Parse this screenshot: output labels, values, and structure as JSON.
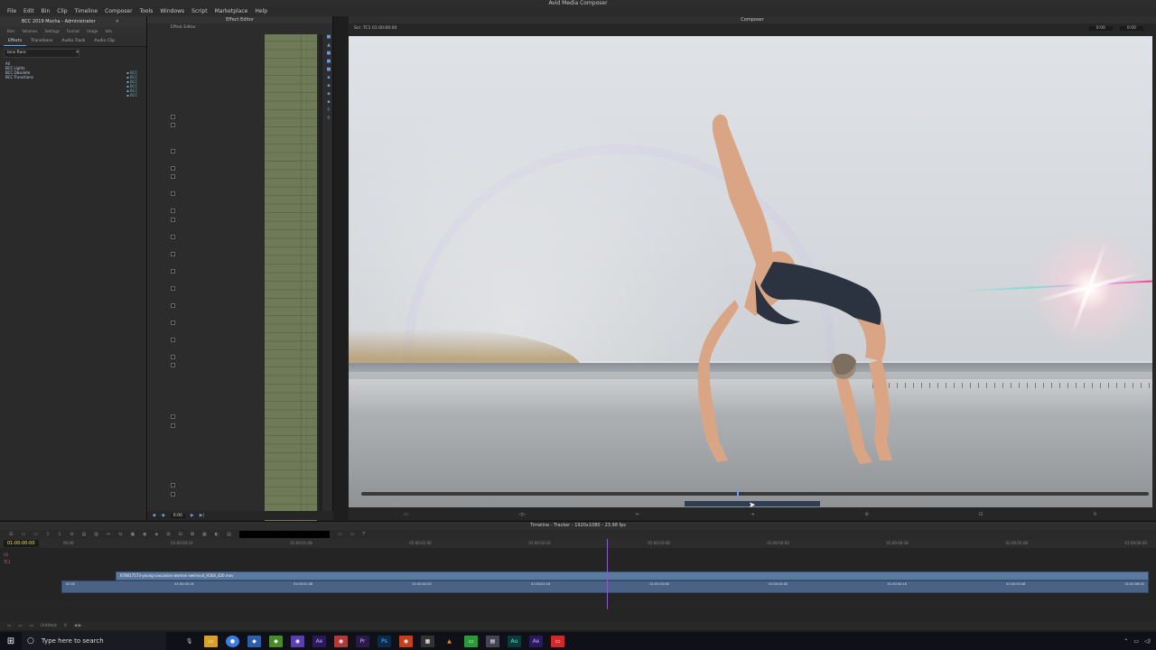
{
  "window": {
    "title": "Avid Media Composer"
  },
  "menu": [
    "File",
    "Edit",
    "Bin",
    "Clip",
    "Timeline",
    "Composer",
    "Tools",
    "Windows",
    "Script",
    "Marketplace",
    "Help"
  ],
  "bin": {
    "title": "BCC 2019 Mocha - Administrator",
    "tabs_top": [
      "Bins",
      "Volumes",
      "Settings",
      "Format",
      "Usage",
      "Info"
    ],
    "tabs_main": [
      "Effects",
      "Transitions",
      "Audio Track",
      "Audio Clip"
    ],
    "search_value": "lens flare",
    "list": [
      "All",
      "BCC Lights",
      "BCC Obsolete",
      "BCC Transitions"
    ]
  },
  "effect_editor": {
    "title": "Effect Editor",
    "tab": "Effect Editor",
    "timecode": "0:00"
  },
  "composer": {
    "title": "Composer",
    "info_left": "Src: TC1  01:00:00:00",
    "info_right": [
      "0:00",
      "0:00"
    ]
  },
  "timeline": {
    "title": "Timeline - Tracker - 1920x1080 - 23.98 fps",
    "timecode": "01:00:00:00",
    "ticks": [
      "00:00",
      "01:00:00:16",
      "01:00:01:08",
      "01:00:02:00",
      "01:00:02:16",
      "01:00:03:08",
      "01:00:04:00",
      "01:00:04:16",
      "01:00:05:08",
      "01:00:06:00"
    ],
    "tracks": [
      "V1",
      "TC1"
    ],
    "clip_name": "678017573-young-caucasian-woman-swimsuit_H264_420.mov",
    "bottom_label": "Untitled"
  },
  "taskbar": {
    "search_placeholder": "Type here to search"
  }
}
